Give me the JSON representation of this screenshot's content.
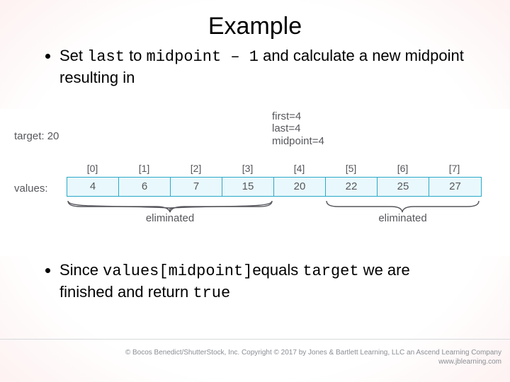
{
  "title": "Example",
  "bullet1": {
    "pre": "Set ",
    "code1": "last",
    "mid1": " to ",
    "code2": "midpoint – 1",
    "mid2": " and calculate a new midpoint resulting in"
  },
  "bullet2": {
    "pre": "Since ",
    "code1": "values[midpoint]",
    "mid1": "equals ",
    "code2": "target",
    "mid2": " we are finished and return ",
    "code3": "true"
  },
  "figure": {
    "target_label": "target: 20",
    "values_label": "values:",
    "state": {
      "first": "first=4",
      "last": "last=4",
      "midpoint": "midpoint=4"
    },
    "indices": [
      "[0]",
      "[1]",
      "[2]",
      "[3]",
      "[4]",
      "[5]",
      "[6]",
      "[7]"
    ],
    "values": [
      "4",
      "6",
      "7",
      "15",
      "20",
      "22",
      "25",
      "27"
    ],
    "eliminated_label": "eliminated"
  },
  "footer": {
    "line1": "© Bocos Benedict/ShutterStock, Inc. Copyright © 2017 by Jones & Bartlett Learning, LLC an Ascend Learning Company",
    "line2": "www.jblearning.com"
  }
}
